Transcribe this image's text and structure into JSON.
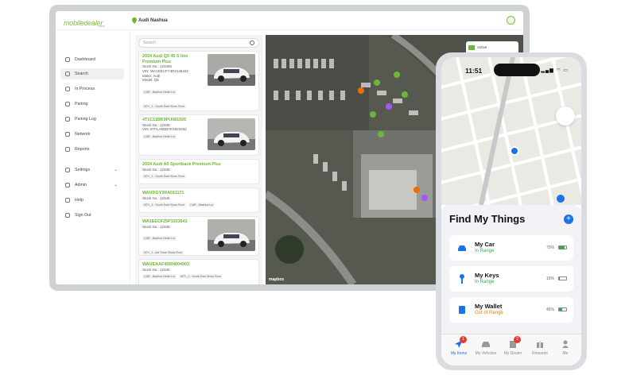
{
  "header": {
    "dealer_name": "Audi Nashua",
    "logo_text": "mobiledealer",
    "logo_sub": "care"
  },
  "sidebar": {
    "items": [
      {
        "label": "Dashboard"
      },
      {
        "label": "Search"
      },
      {
        "label": "In Process"
      },
      {
        "label": "Pairing"
      },
      {
        "label": "Pairing Log"
      },
      {
        "label": "Network"
      },
      {
        "label": "Reports"
      },
      {
        "label": "Settings"
      },
      {
        "label": "Admin"
      },
      {
        "label": "Help"
      },
      {
        "label": "Sign Out"
      }
    ]
  },
  "search": {
    "placeholder": "Search"
  },
  "list": [
    {
      "title": "2024 Audi Q5 45 S line Premium Plus",
      "lines": [
        "Stock No.: 123456",
        "VIN: WA1EECFY4R2148432",
        "Make: Audi",
        "Model: Q5"
      ],
      "tags": [
        "CAR - Nashua North Lot",
        "KEY_1 - South East Show Floor"
      ]
    },
    {
      "title": "4T1C11BK9PU081505",
      "lines": [
        "Stock No.: 12345",
        "VIN: 5TFLA5DB7KX023332"
      ],
      "tags": [
        "CAR - Nashua North Lot"
      ]
    },
    {
      "title": "2024 Audi A5 Sportback Premium Plus",
      "lines": [
        "Stock No.: 12345"
      ],
      "tags": [
        "KEY_1 - South East Show Floor"
      ]
    },
    {
      "title": "WAUDGY3RA011171",
      "lines": [
        "Stock No.: 12345"
      ],
      "tags": [
        "KEY_1 - South East Show Floor",
        "CAR - Nashua Lot"
      ]
    },
    {
      "title": "WA1EECF25P1023642",
      "lines": [
        "Stock No.: 12345"
      ],
      "tags": [
        "CAR - Nashua North Lot",
        "KEY_1 - Avt Track Show Floor"
      ]
    },
    {
      "title": "WAUEAAF45RN004903",
      "lines": [
        "Stock No.: 12345"
      ],
      "tags": [
        "CAR - Nashua North Lot",
        "KEY_1 - South East Show Floor"
      ]
    }
  ],
  "legend": {
    "active": "Active",
    "out_of_network": "Out of network"
  },
  "map_attribution": "mapbox",
  "phone": {
    "time": "11:51",
    "sheet_title": "Find My Things",
    "things": [
      {
        "name": "My Car",
        "status": "In Range",
        "status_color": "#34a853",
        "battery_pct": "75%",
        "battery_color": "#34a853",
        "battery_fill": 0.75
      },
      {
        "name": "My Keys",
        "status": "In Range",
        "status_color": "#34a853",
        "battery_pct": "15%",
        "battery_color": "#e53935",
        "battery_fill": 0.15
      },
      {
        "name": "My Wallet",
        "status": "Out of Range",
        "status_color": "#f57c00",
        "battery_pct": "45%",
        "battery_color": "#34a853",
        "battery_fill": 0.45
      }
    ],
    "tabs": [
      {
        "label": "My Items",
        "badge": "1"
      },
      {
        "label": "My Vehicles",
        "badge": ""
      },
      {
        "label": "My Dealer",
        "badge": "2"
      },
      {
        "label": "Rewards",
        "badge": ""
      },
      {
        "label": "Me",
        "badge": ""
      }
    ]
  },
  "colors": {
    "accent": "#6cb63a",
    "blue": "#1a73e8"
  }
}
